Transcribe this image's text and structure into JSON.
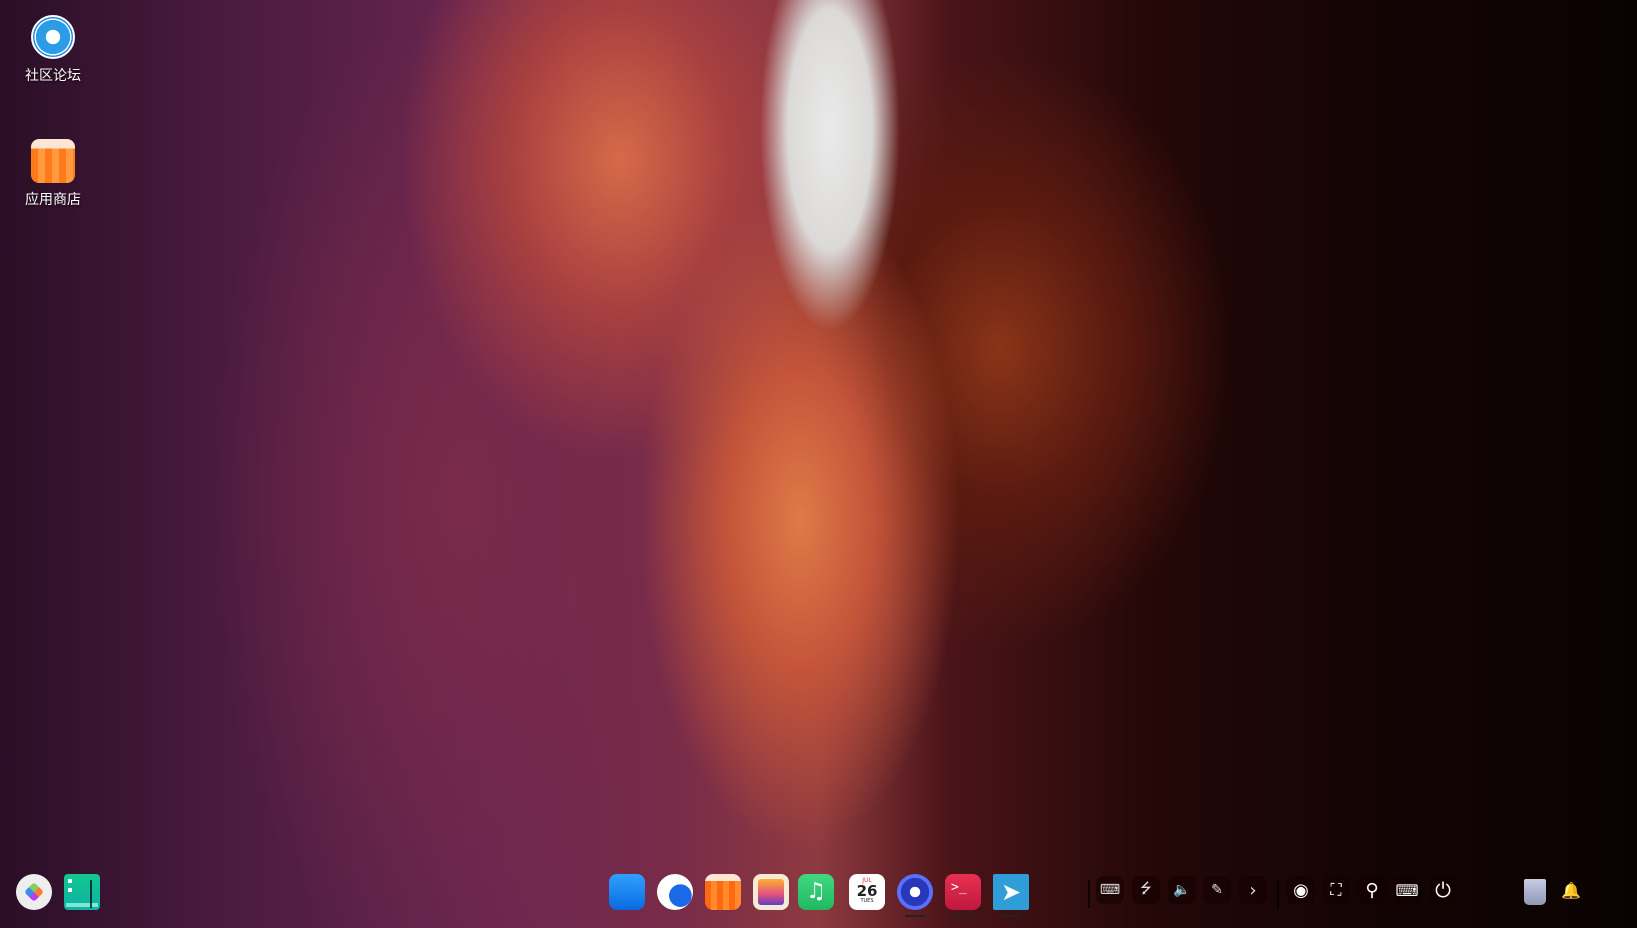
{
  "desktop_icons": [
    {
      "label": "社区论坛",
      "icon": "deepin-forum-icon"
    },
    {
      "label": "应用商店",
      "icon": "app-store-icon"
    }
  ],
  "dock": {
    "left": [
      {
        "name": "launcher",
        "icon": "launcher-icon"
      },
      {
        "name": "multitasking",
        "icon": "multitask-view-icon"
      }
    ],
    "apps": [
      {
        "name": "file-manager",
        "icon": "folder-icon"
      },
      {
        "name": "browser",
        "icon": "browser-icon"
      },
      {
        "name": "app-store",
        "icon": "app-store-icon"
      },
      {
        "name": "image-viewer",
        "icon": "image-viewer-icon"
      },
      {
        "name": "music",
        "icon": "music-icon"
      },
      {
        "name": "calendar",
        "icon": "calendar-icon",
        "month": "JUL",
        "day": "26",
        "weekday": "TUES"
      },
      {
        "name": "control-center",
        "icon": "settings-icon"
      },
      {
        "name": "terminal",
        "icon": "terminal-icon",
        "glyph": ">_"
      },
      {
        "name": "cursor-app",
        "icon": "cursor-icon"
      }
    ],
    "tray": [
      {
        "name": "keyboard",
        "glyph": "⌨"
      },
      {
        "name": "usb",
        "glyph": "⭍"
      },
      {
        "name": "volume",
        "glyph": "🔈"
      },
      {
        "name": "pen",
        "glyph": "✎"
      },
      {
        "name": "expand",
        "glyph": "›"
      }
    ],
    "system": [
      {
        "name": "system-monitor",
        "glyph": "◉"
      },
      {
        "name": "screenshot",
        "glyph": "⛶"
      },
      {
        "name": "search",
        "glyph": "⚲"
      },
      {
        "name": "onscreen-keyboard",
        "glyph": "⌨"
      },
      {
        "name": "power",
        "glyph": "⏻"
      }
    ],
    "right": [
      {
        "name": "trash",
        "icon": "trash-icon"
      },
      {
        "name": "notifications",
        "glyph": "🔔"
      }
    ]
  }
}
